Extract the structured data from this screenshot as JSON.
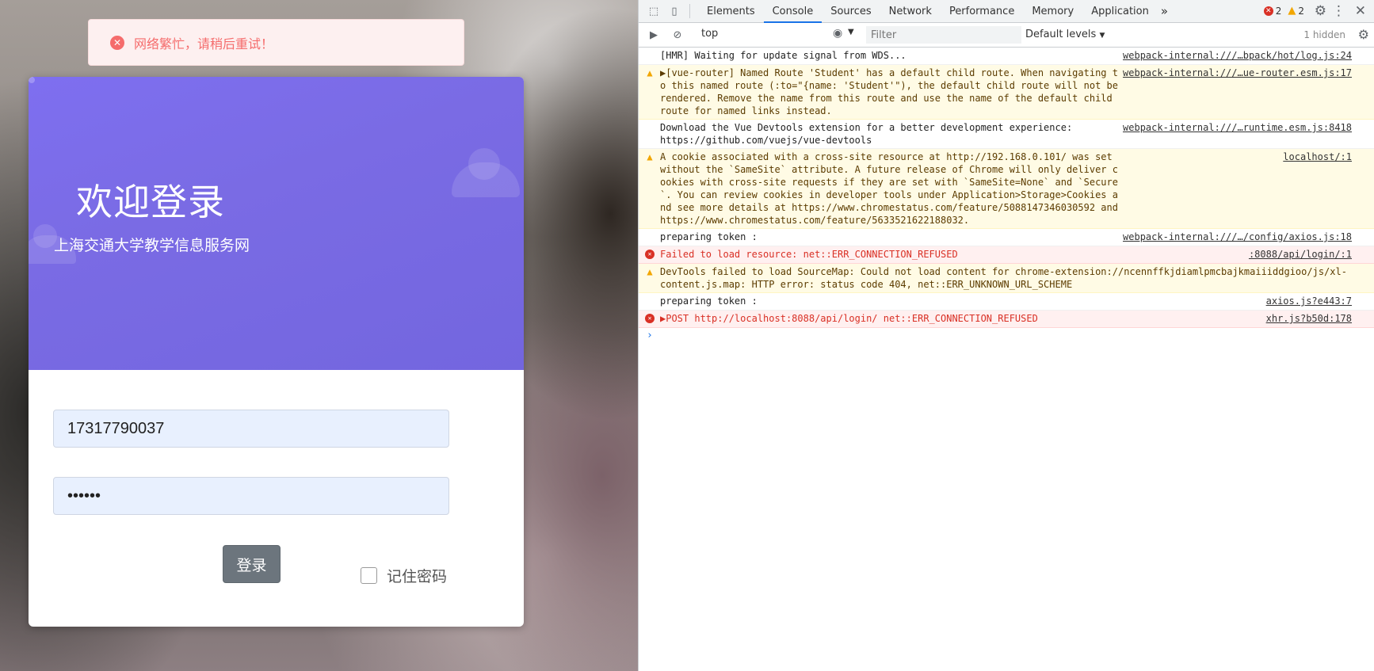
{
  "toast": {
    "message": "网络繁忙，请稍后重试！",
    "icon": "close-circle-icon"
  },
  "login": {
    "title": "欢迎登录",
    "subtitle": "上海交通大学教学信息服务网",
    "username_value": "17317790037",
    "password_value": "••••••",
    "login_button": "登录",
    "remember_label": "记住密码"
  },
  "devtools": {
    "tabs": [
      "Elements",
      "Console",
      "Sources",
      "Network",
      "Performance",
      "Memory",
      "Application"
    ],
    "more": "»",
    "error_count": "2",
    "warning_count": "2",
    "context": "top",
    "filter_placeholder": "Filter",
    "levels": "Default levels",
    "hidden": "1 hidden",
    "logs": [
      {
        "type": "info",
        "text": "[HMR] Waiting for update signal from WDS...",
        "source": "webpack-internal:///…bpack/hot/log.js:24"
      },
      {
        "type": "warn",
        "text": "▶[vue-router] Named Route 'Student' has a default child route. When navigating to this named route (:to=\"{name: 'Student'\"), the default child route will not be rendered. Remove the name from this route and use the name of the default child route for named links instead.",
        "source": "webpack-internal:///…ue-router.esm.js:17"
      },
      {
        "type": "info",
        "text": "Download the Vue Devtools extension for a better development experience:\nhttps://github.com/vuejs/vue-devtools",
        "source": "webpack-internal:///…runtime.esm.js:8418"
      },
      {
        "type": "warn",
        "text": "A cookie associated with a cross-site resource at http://192.168.0.101/ was set without the `SameSite` attribute. A future release of Chrome will only deliver cookies with cross-site requests if they are set with `SameSite=None` and `Secure`. You can review cookies in developer tools under Application>Storage>Cookies and see more details at https://www.chromestatus.com/feature/5088147346030592 and https://www.chromestatus.com/feature/5633521622188032.",
        "source": "localhost/:1"
      },
      {
        "type": "info",
        "text": "preparing token :",
        "source": "webpack-internal:///…/config/axios.js:18"
      },
      {
        "type": "err",
        "text": "Failed to load resource: net::ERR_CONNECTION_REFUSED",
        "source": ":8088/api/login/:1"
      },
      {
        "type": "warn",
        "text": "DevTools failed to load SourceMap: Could not load content for chrome-extension://ncennffkjdiamlpmcbajkmaiiiddgioo/js/xl-content.js.map: HTTP error: status code 404, net::ERR_UNKNOWN_URL_SCHEME",
        "source": ""
      },
      {
        "type": "info",
        "text": "preparing token :",
        "source": "axios.js?e443:7"
      },
      {
        "type": "err",
        "text": "▶POST http://localhost:8088/api/login/ net::ERR_CONNECTION_REFUSED",
        "source": "xhr.js?b50d:178"
      }
    ],
    "prompt": "›"
  },
  "colors": {
    "banner": "#7a6be4",
    "error": "#d93025",
    "warning": "#f2a600",
    "toast_text": "#f56c6c",
    "button": "#6c757d"
  }
}
